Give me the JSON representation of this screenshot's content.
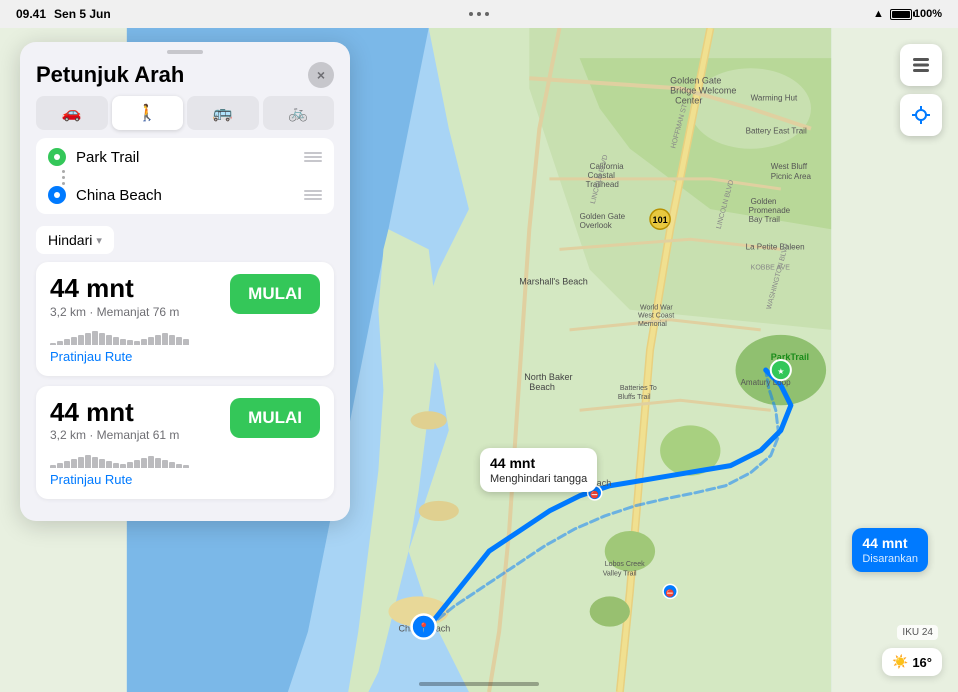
{
  "statusBar": {
    "time": "09.41",
    "date": "Sen 5 Jun",
    "wifi": "WiFi",
    "battery": "100%"
  },
  "panel": {
    "dragHandle": true,
    "title": "Petunjuk Arah",
    "closeLabel": "×",
    "tabs": [
      {
        "id": "car",
        "icon": "🚗",
        "label": "Mobil",
        "active": false
      },
      {
        "id": "walk",
        "icon": "🚶",
        "label": "Jalan Kaki",
        "active": true
      },
      {
        "id": "transit",
        "icon": "🚌",
        "label": "Transit",
        "active": false
      },
      {
        "id": "bike",
        "icon": "🚲",
        "label": "Sepeda",
        "active": false
      }
    ],
    "waypoints": [
      {
        "id": "origin",
        "dotColor": "green",
        "label": "Park Trail"
      },
      {
        "id": "dest",
        "dotColor": "blue",
        "label": "China Beach"
      }
    ],
    "avoidLabel": "Hindari",
    "routes": [
      {
        "time": "44 mnt",
        "meta": "3,2 km · Memanjat 76 m",
        "startLabel": "MULAI",
        "previewLabel": "Pratinjau Rute",
        "elevations": [
          2,
          4,
          6,
          8,
          10,
          12,
          14,
          12,
          10,
          8,
          6,
          5,
          4,
          6,
          8,
          10,
          12,
          10,
          8,
          6
        ]
      },
      {
        "time": "44 mnt",
        "meta": "3,2 km · Memanjat 61 m",
        "startLabel": "MULAI",
        "previewLabel": "Pratinjau Rute",
        "elevations": [
          3,
          5,
          7,
          9,
          11,
          13,
          11,
          9,
          7,
          5,
          4,
          6,
          8,
          10,
          12,
          10,
          8,
          6,
          4,
          3
        ]
      }
    ]
  },
  "map": {
    "callout1": {
      "line1": "44 mnt",
      "line2": "Menghindari tangga"
    },
    "callout2": {
      "line1": "44 mnt",
      "line2": "Disarankan"
    },
    "weather": {
      "temp": "16°",
      "icon": "☀️"
    },
    "scale": "IKU 24"
  }
}
